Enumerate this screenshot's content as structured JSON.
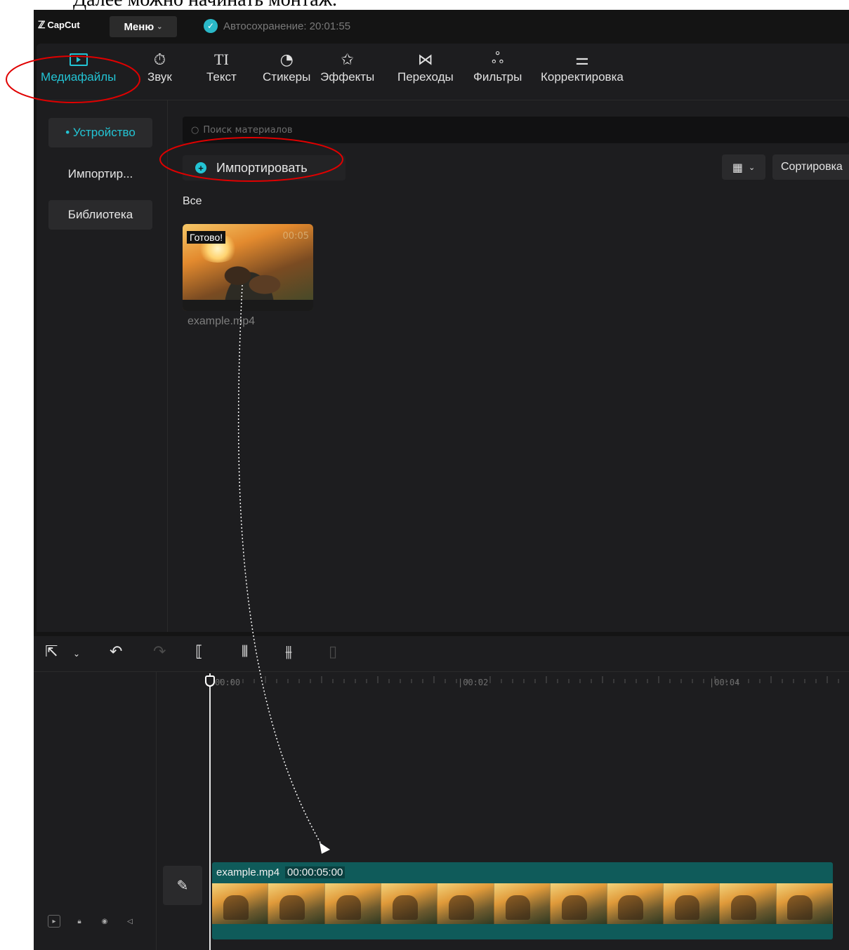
{
  "document": {
    "caption": "Далее можно начинать монтаж."
  },
  "titlebar": {
    "logo": "CapCut",
    "menu_label": "Меню",
    "autosave": "Автосохранение: 20:01:55"
  },
  "tabs": [
    {
      "label": "Медиафайлы",
      "icon": "media-icon",
      "active": true
    },
    {
      "label": "Звук",
      "icon": "audio-icon"
    },
    {
      "label": "Текст",
      "icon": "text-icon",
      "glyph": "TI"
    },
    {
      "label": "Стикеры",
      "icon": "sticker-icon"
    },
    {
      "label": "Эффекты",
      "icon": "effects-icon"
    },
    {
      "label": "Переходы",
      "icon": "transitions-icon"
    },
    {
      "label": "Фильтры",
      "icon": "filters-icon"
    },
    {
      "label": "Корректировка",
      "icon": "adjust-icon"
    }
  ],
  "sidebar": {
    "items": [
      {
        "label": "• Устройство",
        "active": true
      },
      {
        "label": "Импортир..."
      },
      {
        "label": "Библиотека"
      }
    ]
  },
  "media": {
    "search_placeholder": "Поиск материалов",
    "import_label": "Импортировать",
    "sort_label": "Сортировка",
    "all_label": "Все",
    "item": {
      "badge": "Готово!",
      "duration": "00:05",
      "filename": "example.mp4"
    }
  },
  "timeline": {
    "ticks": [
      "00:00",
      "|00:02",
      "|00:04"
    ],
    "clip": {
      "name": "example.mp4",
      "duration": "00:00:05:00"
    }
  },
  "colors": {
    "accent": "#23c4d4",
    "annotation": "#e00000",
    "clip": "#0f5b5a"
  }
}
